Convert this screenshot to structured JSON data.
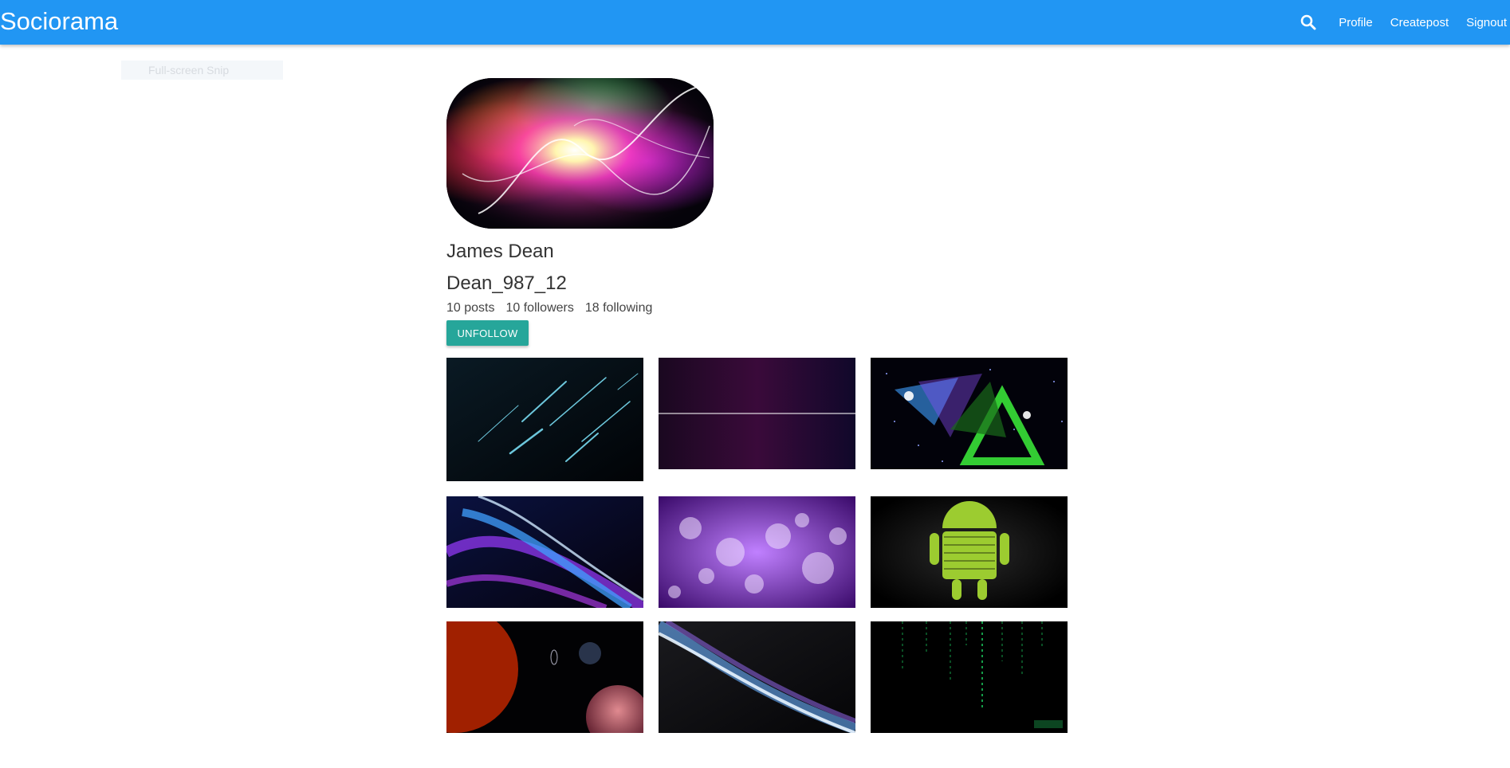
{
  "navbar": {
    "brand": "Sociorama",
    "search_icon": "search-icon",
    "links": {
      "profile": "Profile",
      "createpost": "Createpost",
      "signout": "Signout"
    }
  },
  "overlay": {
    "snip_label": "Full-screen Snip"
  },
  "profile": {
    "name": "James Dean",
    "username": "Dean_987_12",
    "stats": {
      "posts": "10 posts",
      "followers": "10 followers",
      "following": "18 following"
    },
    "unfollow_label": "UNFOLLOW"
  },
  "colors": {
    "navbar": "#2196f3",
    "button": "#26a69a"
  },
  "posts": [
    {
      "alt": "streaks"
    },
    {
      "alt": "soundwave"
    },
    {
      "alt": "triangles"
    },
    {
      "alt": "blue-purple-lines"
    },
    {
      "alt": "purple-bokeh"
    },
    {
      "alt": "android-word-cloud"
    },
    {
      "alt": "sun-planets"
    },
    {
      "alt": "light-wave"
    },
    {
      "alt": "matrix-code"
    }
  ]
}
